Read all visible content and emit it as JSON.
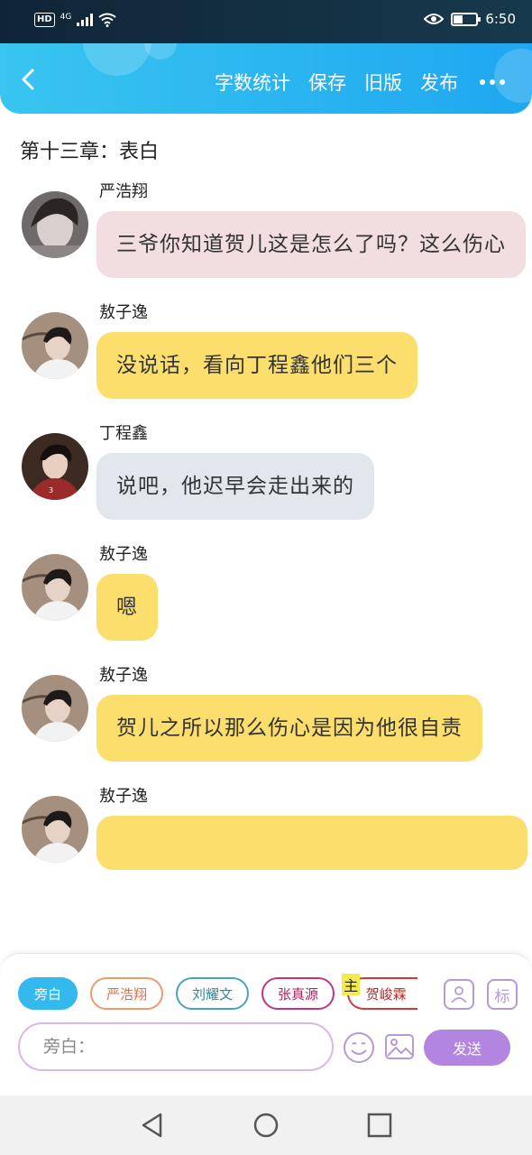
{
  "status_bar": {
    "hd": "HD",
    "network": "4G",
    "time": "6:50",
    "battery_level": 0.4
  },
  "header": {
    "actions": [
      "字数统计",
      "保存",
      "旧版",
      "发布"
    ]
  },
  "chapter_title": "第十三章：表白",
  "messages": [
    {
      "name": "严浩翔",
      "text": "三爷你知道贺儿这是怎么了吗？这么伤心",
      "color": "#f2dde0"
    },
    {
      "name": "敖子逸",
      "text": "没说话，看向丁程鑫他们三个",
      "color": "#fcde6d"
    },
    {
      "name": "丁程鑫",
      "text": "说吧，他迟早会走出来的",
      "color": "#e2e7ee"
    },
    {
      "name": "敖子逸",
      "text": "嗯",
      "color": "#fcde6d"
    },
    {
      "name": "敖子逸",
      "text": "贺儿之所以那么伤心是因为他很自责",
      "color": "#fcde6d"
    },
    {
      "name": "敖子逸",
      "text": "",
      "color": "#fcde6d"
    }
  ],
  "panel": {
    "chips": [
      {
        "label": "旁白",
        "color": "#33b9ee"
      },
      {
        "label": "严浩翔",
        "color": "#f09a6a"
      },
      {
        "label": "刘耀文",
        "color": "#4aa3b9"
      },
      {
        "label": "张真源",
        "color": "#c7337a"
      },
      {
        "label": "贺峻霖",
        "color": "#d23a3a"
      }
    ],
    "main_tag": "主",
    "mark_button": "标",
    "input_placeholder": "旁白：",
    "send_label": "发送"
  }
}
